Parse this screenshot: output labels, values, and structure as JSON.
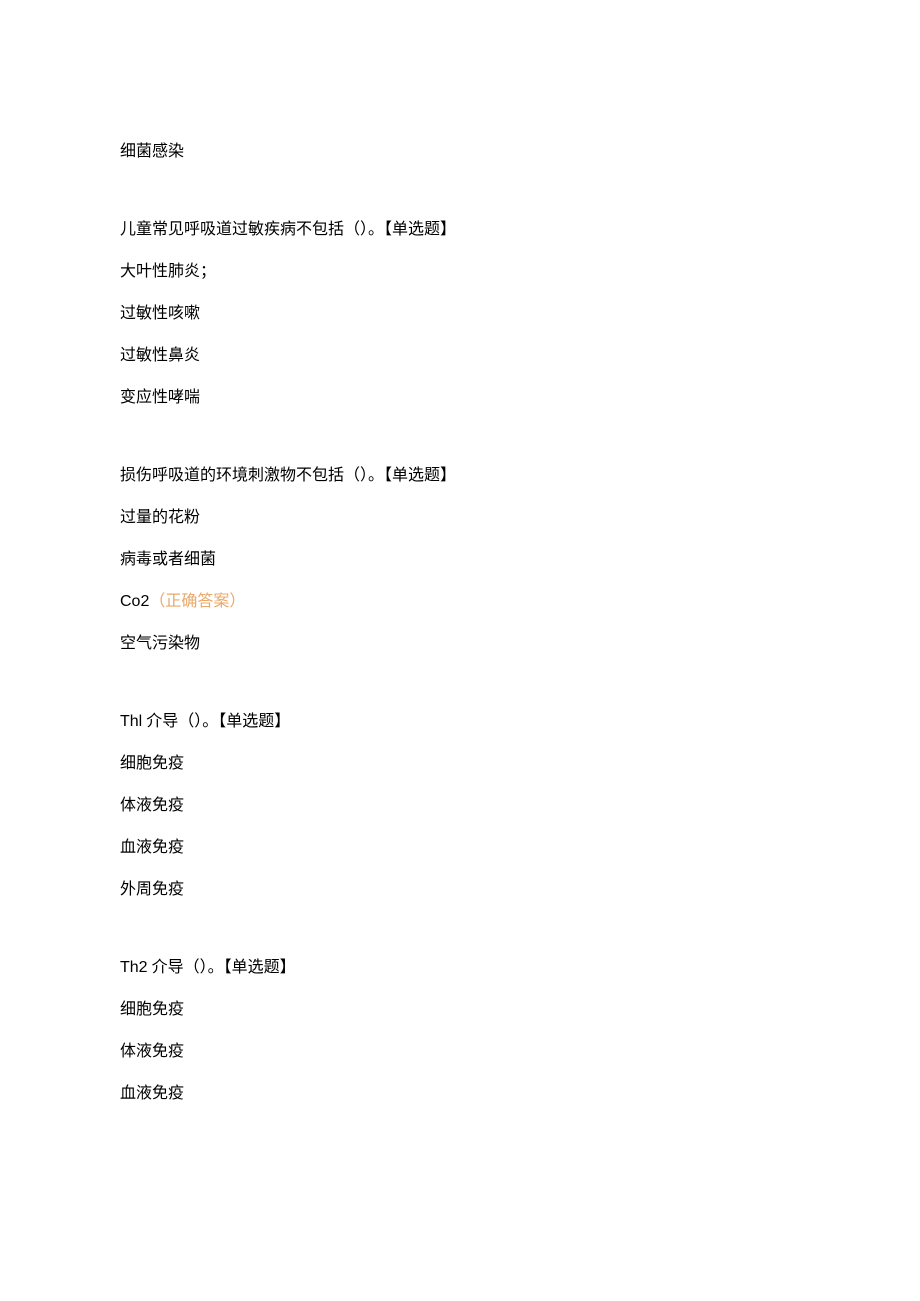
{
  "top_fragment": "细菌感染",
  "questions": [
    {
      "stem": "儿童常见呼吸道过敏疾病不包括（）。【单选题】",
      "options": [
        {
          "text": "大叶性肺炎；",
          "correct": false
        },
        {
          "text": "过敏性咳嗽",
          "correct": false
        },
        {
          "text": "过敏性鼻炎",
          "correct": false
        },
        {
          "text": "变应性哮喘",
          "correct": false
        }
      ]
    },
    {
      "stem": "损伤呼吸道的环境刺激物不包括（）。【单选题】",
      "options": [
        {
          "text": "过量的花粉",
          "correct": false
        },
        {
          "text": "病毒或者细菌",
          "correct": false
        },
        {
          "text": "Co2",
          "correct": true,
          "latin": true
        },
        {
          "text": "空气污染物",
          "correct": false
        }
      ]
    },
    {
      "stem_prefix_latin": "Thl",
      "stem_suffix": " 介导（）。【单选题】",
      "options": [
        {
          "text": "细胞免疫",
          "correct": false
        },
        {
          "text": "体液免疫",
          "correct": false
        },
        {
          "text": "血液免疫",
          "correct": false
        },
        {
          "text": "外周免疫",
          "correct": false
        }
      ]
    },
    {
      "stem_prefix_latin": "Th2",
      "stem_suffix": " 介导（）。【单选题】",
      "options": [
        {
          "text": "细胞免疫",
          "correct": false
        },
        {
          "text": "体液免疫",
          "correct": false
        },
        {
          "text": "血液免疫",
          "correct": false
        }
      ]
    }
  ],
  "correct_label": "（正确答案）"
}
